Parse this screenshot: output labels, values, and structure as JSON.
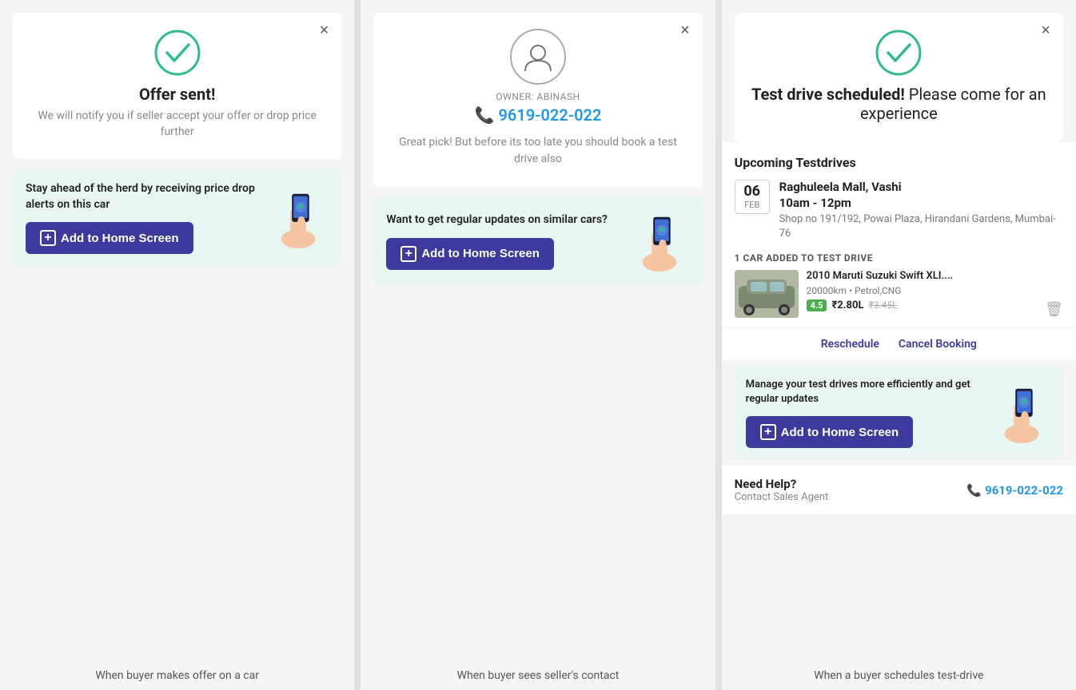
{
  "panel1": {
    "close_label": "×",
    "title": "Offer sent!",
    "subtitle": "We will notify you if seller accept your offer or drop price further",
    "promo_text": "Stay ahead of the herd by receiving price drop alerts on this car",
    "add_btn_label": "Add to Home Screen",
    "bottom_label": "When buyer makes offer on a car"
  },
  "panel2": {
    "close_label": "×",
    "owner_label": "OWNER: ABINASH",
    "owner_phone": "9619-022-022",
    "desc": "Great pick! But before its too late you should book a test drive also",
    "promo_text": "Want to get regular updates on similar cars?",
    "add_btn_label": "Add to Home Screen",
    "bottom_label": "When buyer sees seller's contact"
  },
  "panel3": {
    "close_label": "×",
    "title_bold": "Test drive scheduled!",
    "title_normal": " Please come for an experience",
    "upcoming_title": "Upcoming Testdrives",
    "date_num": "06",
    "date_month": "FEB",
    "venue": "Raghuleela Mall, Vashi",
    "time": "10am - 12pm",
    "address": "Shop no 191/192, Powai Plaza, Hirandani Gardens, Mumbai-76",
    "car_added_label": "1 CAR ADDED TO TEST DRIVE",
    "car_name": "2010 Maruti Suzuki Swift XLI....",
    "car_meta": "20000km • Petrol,CNG",
    "rating": "4.5",
    "car_price": "₹2.80L",
    "car_price_old": "₹3.45L",
    "reschedule_label": "Reschedule",
    "cancel_label": "Cancel Booking",
    "promo_text": "Manage your test drives more efficiently and get regular updates",
    "add_btn_label": "Add to Home Screen",
    "help_title": "Need Help?",
    "help_sub": "Contact Sales Agent",
    "help_phone": "9619-022-022",
    "bottom_label": "When a buyer schedules test-drive"
  },
  "colors": {
    "green": "#2fbb8f",
    "blue_btn": "#3d3a9e",
    "phone_blue": "#2196f3"
  }
}
